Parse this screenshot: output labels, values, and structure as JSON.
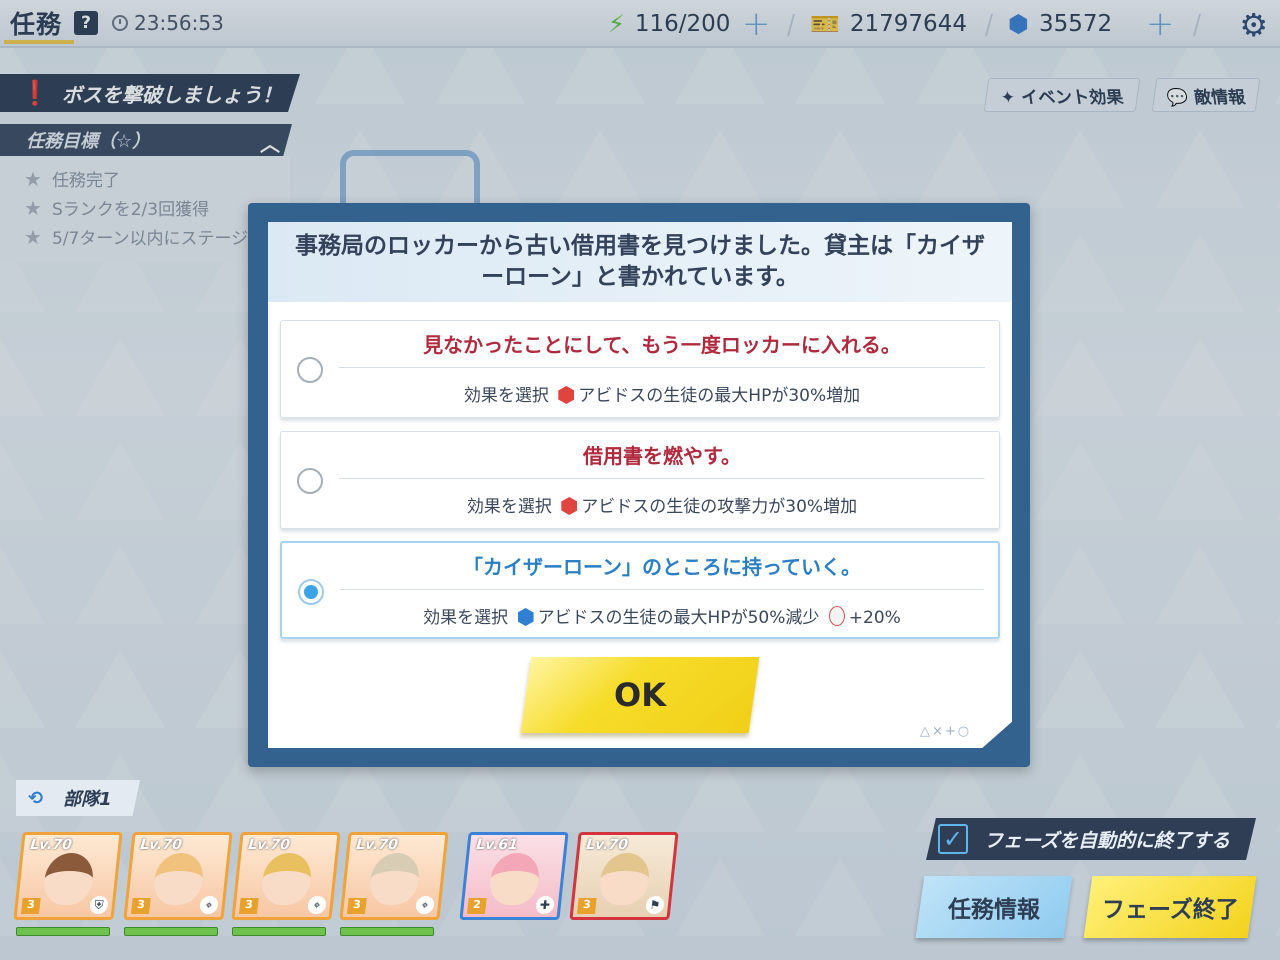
{
  "topbar": {
    "title": "任務",
    "help": "?",
    "timer": "23:56:53",
    "ap": "116/200",
    "credits": "21797644",
    "gems": "35572"
  },
  "mission": {
    "banner": "ボスを撃破しましょう！",
    "objective_header": "任務目標（☆）",
    "objectives": [
      "任務完了",
      "Sランクを2/3回獲得",
      "5/7ターン以内にステージ"
    ]
  },
  "buttons": {
    "event_effect": "イベント効果",
    "enemy_info": "敵情報",
    "ok": "OK",
    "mission_info": "任務情報",
    "phase_end": "フェーズ終了",
    "auto_end": "フェーズを自動的に終了する"
  },
  "dialog": {
    "message": "事務局のロッカーから古い借用書を見つけました。貸主は「カイザーローン」と書かれています。",
    "choices": [
      {
        "title": "見なかったことにして、もう一度ロッカーに入れる。",
        "effect_prefix": "効果を選択",
        "effect": "アビドスの生徒の最大HPが30%増加",
        "extra": ""
      },
      {
        "title": "借用書を燃やす。",
        "effect_prefix": "効果を選択",
        "effect": "アビドスの生徒の攻撃力が30%増加",
        "extra": ""
      },
      {
        "title": "「カイザーローン」のところに持っていく。",
        "effect_prefix": "効果を選択",
        "effect": "アビドスの生徒の最大HPが50%減少",
        "extra": "+20%"
      }
    ],
    "selected_index": 2,
    "deco": "△×+○"
  },
  "squad": {
    "label": "部隊1",
    "members": [
      {
        "level": "Lv.70",
        "stars": "3",
        "role": "shield-icon"
      },
      {
        "level": "Lv.70",
        "stars": "3",
        "role": "crosshair-icon"
      },
      {
        "level": "Lv.70",
        "stars": "3",
        "role": "crosshair-icon"
      },
      {
        "level": "Lv.70",
        "stars": "3",
        "role": "crosshair-icon"
      },
      {
        "level": "Lv.61",
        "stars": "2",
        "role": "heal-icon"
      },
      {
        "level": "Lv.70",
        "stars": "3",
        "role": "support-icon"
      }
    ]
  },
  "colors": {
    "accent_blue": "#2f7fd2",
    "choice_red": "#b02a3e",
    "selected_blue": "#2b7fc4",
    "ok_yellow": "#f6dc2a",
    "panel_dark": "#2f3e55"
  }
}
